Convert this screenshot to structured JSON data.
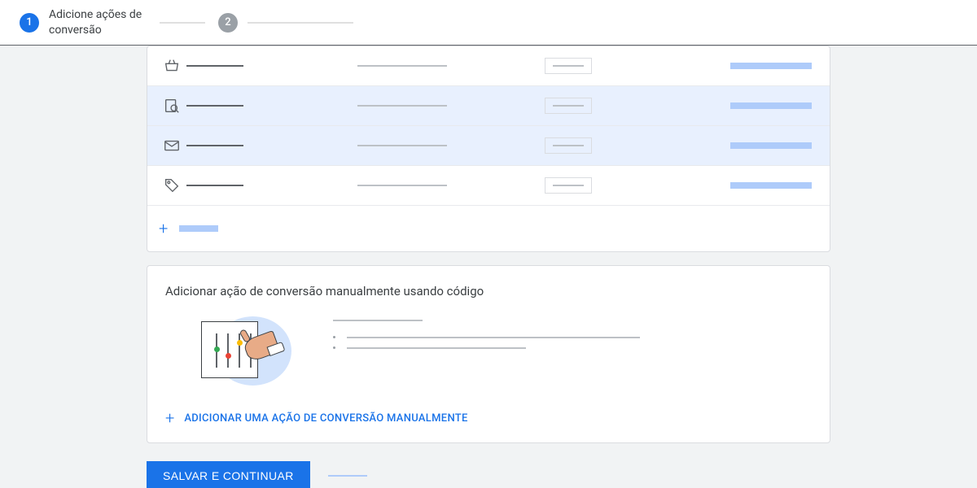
{
  "header": {
    "step1_number": "1",
    "step1_label": "Adicione ações de conversão",
    "step2_number": "2"
  },
  "rows": [
    {
      "icon": "basket-icon",
      "selected": false
    },
    {
      "icon": "search-page-icon",
      "selected": true
    },
    {
      "icon": "envelope-icon",
      "selected": true
    },
    {
      "icon": "tag-icon",
      "selected": false
    }
  ],
  "manual": {
    "title": "Adicionar ação de conversão manualmente usando código",
    "add_label": "ADICIONAR UMA AÇÃO DE CONVERSÃO MANUALMENTE"
  },
  "footer": {
    "save_label": "SALVAR E CONTINUAR"
  }
}
